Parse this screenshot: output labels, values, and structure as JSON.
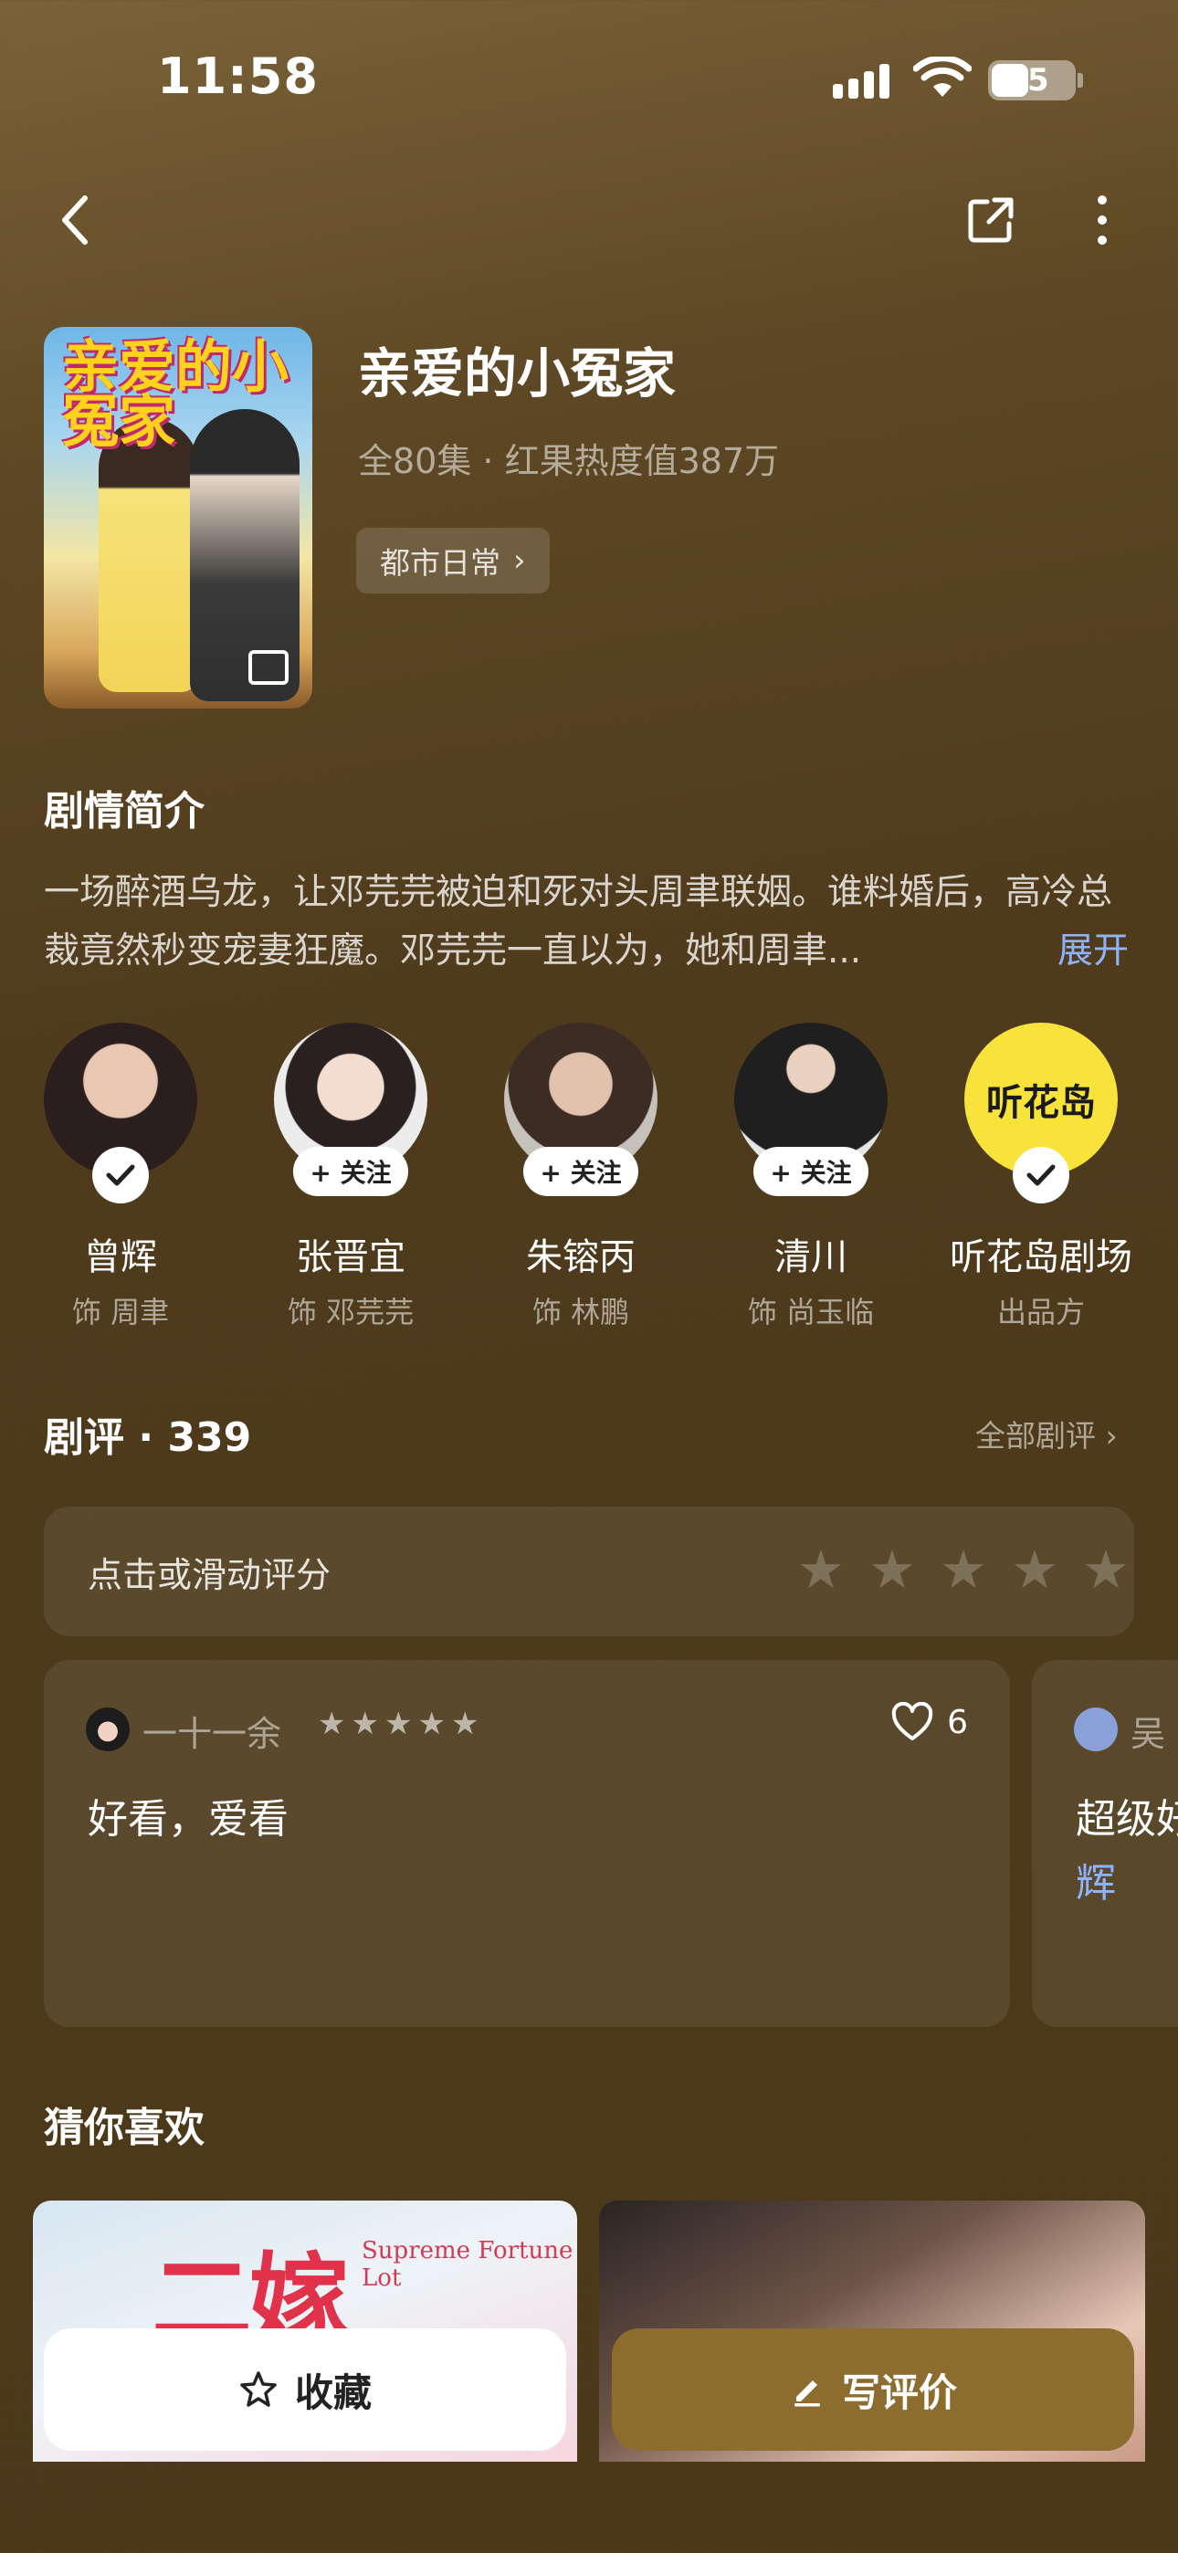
{
  "status_bar": {
    "time": "11:58",
    "battery": "45",
    "battery_level": 0.45
  },
  "nav": {
    "back_icon": "chevron-left-icon",
    "share_icon": "share-icon",
    "more_icon": "more-vertical-icon"
  },
  "drama": {
    "poster_title": "亲爱的小冤家",
    "title": "亲爱的小冤家",
    "meta": "全80集 · 红果热度值387万",
    "genre": "都市日常",
    "genre_chevron": "›"
  },
  "synopsis": {
    "title": "剧情简介",
    "text": "一场醉酒乌龙，让邓芫芫被迫和死对头周聿联姻。谁料婚后，高冷总裁竟然秒变宠妻狂魔。邓芫芫一直以为，她和周聿...",
    "expand": "展开"
  },
  "cast": [
    {
      "name": "曾辉",
      "role": "饰 周聿",
      "status": "followed",
      "follow_label": ""
    },
    {
      "name": "张晋宜",
      "role": "饰 邓芫芫",
      "status": "follow",
      "follow_label": "+ 关注"
    },
    {
      "name": "朱镕丙",
      "role": "饰 林鹏",
      "status": "follow",
      "follow_label": "+ 关注"
    },
    {
      "name": "清川",
      "role": "饰 尚玉临",
      "status": "follow",
      "follow_label": "+ 关注"
    },
    {
      "name": "听花岛剧场",
      "role": "出品方",
      "status": "followed",
      "follow_label": "",
      "logo_text": "听花岛"
    }
  ],
  "reviews": {
    "title": "剧评 · 339",
    "all_label": "全部剧评 ›",
    "rate_prompt": "点击或滑动评分",
    "rate_stars": [
      "★",
      "★",
      "★",
      "★",
      "★"
    ],
    "cards": [
      {
        "user": "一十一余",
        "stars": [
          "★",
          "★",
          "★",
          "★",
          "★"
        ],
        "rating": 5,
        "likes": "6",
        "text": "好看，爱看"
      },
      {
        "user": "吴",
        "text": "超级好",
        "link": "辉"
      }
    ]
  },
  "recommend": {
    "title": "猜你喜欢",
    "items": [
      {
        "poster_title": "二嫁",
        "poster_subtitle": "Supreme Fortune Lot"
      },
      {
        "poster_title": ""
      }
    ]
  },
  "bottom_bar": {
    "collect_label": "收藏",
    "write_label": "写评价"
  },
  "colors": {
    "accent": "#8d6d2f",
    "link": "#8fb4ff",
    "background": "#4f3b1c"
  }
}
